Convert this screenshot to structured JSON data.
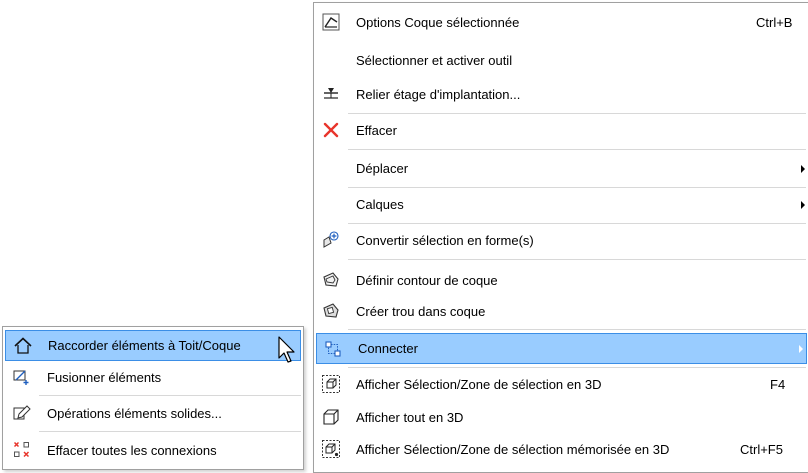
{
  "main_menu": {
    "items": [
      {
        "label": "Options Coque sélectionnée",
        "shortcut": "Ctrl+B",
        "icon": "shell-options-icon"
      },
      {
        "label": "Sélectionner et activer outil"
      },
      {
        "label": "Relier étage d'implantation...",
        "icon": "link-story-icon"
      },
      {
        "label": "Effacer",
        "icon": "delete-x-icon"
      },
      {
        "label": "Déplacer",
        "submenu": true
      },
      {
        "label": "Calques",
        "submenu": true
      },
      {
        "label": "Convertir sélection en forme(s)",
        "icon": "convert-to-morph-icon"
      },
      {
        "label": "Définir contour de coque",
        "icon": "shell-contour-icon"
      },
      {
        "label": "Créer trou dans coque",
        "icon": "shell-hole-icon"
      },
      {
        "label": "Connecter",
        "submenu": true,
        "highlighted": true,
        "icon": "connect-icon"
      },
      {
        "label": "Afficher Sélection/Zone de sélection en 3D",
        "shortcut": "F4",
        "icon": "show-selection-3d-icon"
      },
      {
        "label": "Afficher tout en 3D",
        "icon": "show-all-3d-icon"
      },
      {
        "label": "Afficher Sélection/Zone de sélection mémorisée en 3D",
        "shortcut": "Ctrl+F5",
        "icon": "show-stored-selection-3d-icon"
      }
    ]
  },
  "sub_menu": {
    "items": [
      {
        "label": "Raccorder éléments à Toit/Coque",
        "highlighted": true,
        "icon": "trim-to-roof-icon"
      },
      {
        "label": "Fusionner éléments",
        "icon": "merge-elements-icon"
      },
      {
        "label": "Opérations éléments solides...",
        "icon": "solid-operations-icon"
      },
      {
        "label": "Effacer toutes les connexions",
        "icon": "remove-connections-icon"
      }
    ]
  },
  "colors": {
    "highlight_bg": "#99ccff",
    "highlight_border": "#3b8ee6",
    "delete_red": "#e8342b"
  }
}
